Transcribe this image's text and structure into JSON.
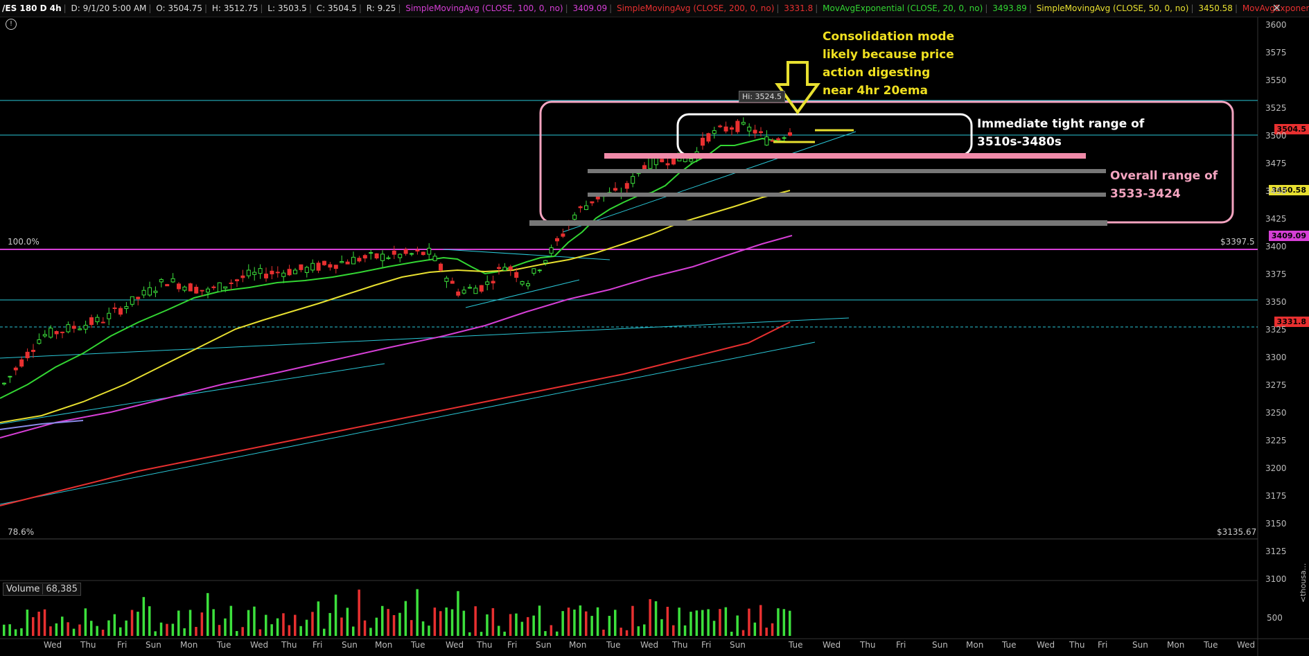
{
  "header": {
    "symbol": "/ES 180 D 4h",
    "date": "D: 9/1/20 5:00 AM",
    "open": "O: 3504.75",
    "high": "H: 3512.75",
    "low": "L: 3503.5",
    "close": "C: 3504.5",
    "range": "R: 9.25",
    "studies": [
      {
        "label": "SimpleMovingAvg (CLOSE, 100, 0, no)",
        "value": "3409.09",
        "color": "#d63fd6"
      },
      {
        "label": "SimpleMovingAvg (CLOSE, 200, 0, no)",
        "value": "3331.8",
        "color": "#e83030"
      },
      {
        "label": "MovAvgExponential (CLOSE, 20, 0, no)",
        "value": "3493.89",
        "color": "#33d633"
      },
      {
        "label": "SimpleMovingAvg (CLOSE, 50, 0, no)",
        "value": "3450.58",
        "color": "#e8e030"
      },
      {
        "label": "MovAvgExponential (CLOSE,...",
        "value": "",
        "color": "#e83030"
      }
    ],
    "close_icon": "close-icon"
  },
  "annotations": {
    "consolidation": "Consolidation mode likely because price action digesting near 4hr 20ema",
    "consolidation_lines": [
      "Consolidation mode",
      "likely because price",
      "action digesting",
      "near 4hr 20ema"
    ],
    "tight_range_lines": [
      "Immediate tight range of",
      "3510s-3480s"
    ],
    "overall_range_lines": [
      "Overall range of",
      "3533-3424"
    ],
    "hi_label": "Hi: 3524.5",
    "fib_top": "100.0%",
    "fib_bottom": "78.6%",
    "fib_top_price": "$3397.5",
    "fib_bottom_price": "$3135.67"
  },
  "price_tags": [
    {
      "value": "3504.5",
      "bg": "#e83030",
      "fg": "#000"
    },
    {
      "value": "3450.58",
      "bg": "#e8e030",
      "fg": "#000"
    },
    {
      "value": "3409.09",
      "bg": "#d63fd6",
      "fg": "#000"
    },
    {
      "value": "3331.8",
      "bg": "#e83030",
      "fg": "#000"
    }
  ],
  "volume": {
    "label": "Volume",
    "value": "68,385",
    "axis_label": "500",
    "unit_label": "<thousa..."
  },
  "chart_data": {
    "type": "candlestick",
    "y_axis_ticks": [
      3600,
      3575,
      3550,
      3525,
      3500,
      3475,
      3450,
      3425,
      3400,
      3375,
      3350,
      3325,
      3300,
      3275,
      3250,
      3225,
      3200,
      3175,
      3150,
      3125,
      3100
    ],
    "y_axis_tick_labels": [
      "3600",
      "3575",
      "3550",
      "3525",
      "3500",
      "3475",
      "3450",
      "3425",
      "3400",
      "3375",
      "3350",
      "3325",
      "3300",
      "3275",
      "3250",
      "3225",
      "3200",
      "3175",
      "3150",
      "3125",
      "3100"
    ],
    "x_axis_labels": [
      "Wed",
      "Thu",
      "Fri",
      "Sun",
      "Mon",
      "Tue",
      "Wed",
      "Thu",
      "Fri",
      "Sun",
      "Mon",
      "Tue",
      "Wed",
      "Thu",
      "Fri",
      "Sun",
      "Mon",
      "Tue",
      "Wed",
      "Thu",
      "Fri",
      "Sun",
      "Tue",
      "Wed",
      "Thu",
      "Fri",
      "Sun",
      "Mon",
      "Tue",
      "Wed",
      "Thu",
      "Fri",
      "Sun",
      "Mon",
      "Tue",
      "Wed"
    ],
    "ylim": [
      3100,
      3610
    ],
    "grid": false,
    "colors": {
      "up": "#3ce03c",
      "down": "#e83030"
    }
  }
}
